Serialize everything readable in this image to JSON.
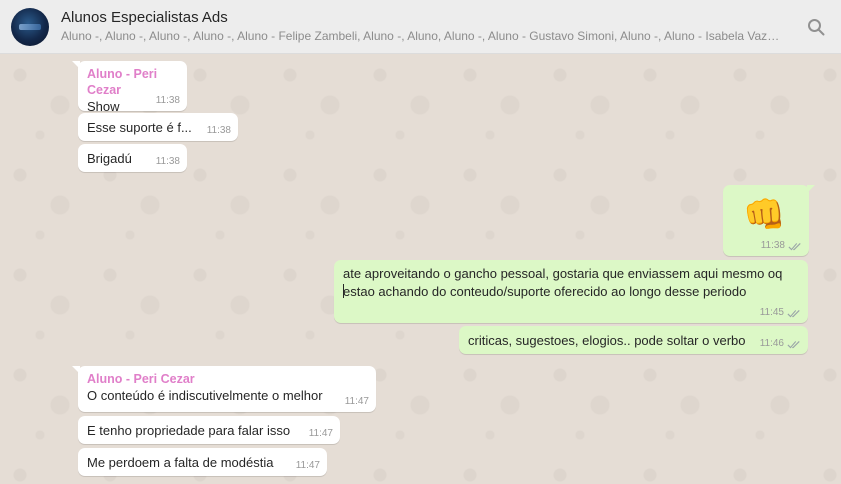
{
  "header": {
    "title": "Alunos Especialistas Ads",
    "participants": "Aluno -, Aluno -, Aluno -, Aluno -, Aluno - Felipe Zambeli, Aluno -, Aluno, Aluno -, Aluno - Gustavo Simoni, Aluno -, Aluno - Isabela Vaz, A...",
    "search_icon": "search-icon"
  },
  "colors": {
    "incoming_bubble": "#ffffff",
    "outgoing_bubble": "#dcf8c6",
    "sender_name": "#e07fc9",
    "wallpaper": "#e5ddd5"
  },
  "messages": [
    {
      "direction": "in",
      "sender": "Aluno - Peri Cezar",
      "text": "Show",
      "time": "11:38"
    },
    {
      "direction": "in",
      "text": "Esse suporte é f...",
      "time": "11:38"
    },
    {
      "direction": "in",
      "text": "Brigadú",
      "time": "11:38"
    },
    {
      "direction": "out",
      "emoji": "👊",
      "time": "11:38",
      "status": "read"
    },
    {
      "direction": "out",
      "line1": "ate aproveitando o gancho pessoal, gostaria que enviassem aqui mesmo oq",
      "line2": "estao achando do conteudo/suporte oferecido ao longo desse periodo",
      "time": "11:45",
      "status": "read"
    },
    {
      "direction": "out",
      "text": "criticas, sugestoes, elogios.. pode soltar o verbo",
      "time": "11:46",
      "status": "read"
    },
    {
      "direction": "in",
      "sender": "Aluno - Peri Cezar",
      "text": "O conteúdo é indiscutivelmente o melhor",
      "time": "11:47"
    },
    {
      "direction": "in",
      "text": "E tenho propriedade para falar isso",
      "time": "11:47"
    },
    {
      "direction": "in",
      "text": "Me perdoem a falta de modéstia",
      "time": "11:47"
    }
  ]
}
